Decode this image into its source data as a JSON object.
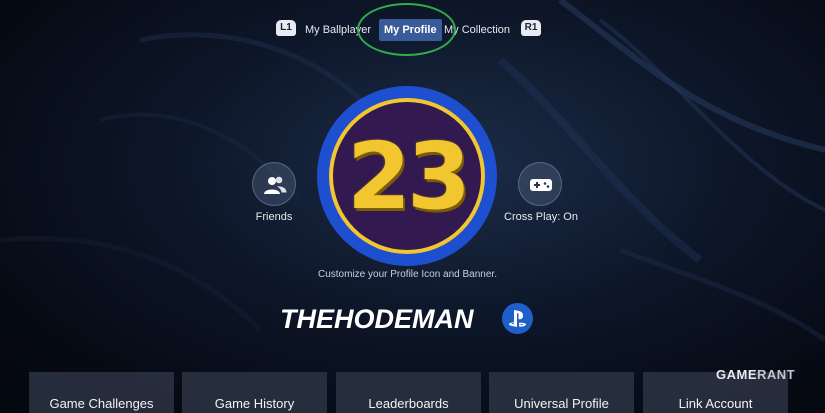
{
  "tabs": {
    "left_bumper": "L1",
    "right_bumper": "R1",
    "items": [
      {
        "label": "My Ballplayer",
        "active": false
      },
      {
        "label": "My Profile",
        "active": true
      },
      {
        "label": "My Collection",
        "active": false
      }
    ]
  },
  "profile": {
    "icon_number": "23",
    "customize_hint": "Customize your Profile Icon and Banner.",
    "username": "THEHODEMAN",
    "platform_icon": "playstation-icon"
  },
  "side_buttons": {
    "friends": {
      "label": "Friends",
      "icon": "friends-icon"
    },
    "crossplay": {
      "label": "Cross Play: On",
      "icon": "gamepad-icon"
    }
  },
  "menu": [
    {
      "label": "Game Challenges"
    },
    {
      "label": "Game History"
    },
    {
      "label": "Leaderboards"
    },
    {
      "label": "Universal Profile"
    },
    {
      "label": "Link Account"
    }
  ],
  "watermark": {
    "part1": "GAME",
    "part2": "RANT"
  },
  "colors": {
    "active_tab": "#3a5b9a",
    "badge_blue": "#1e4fd1",
    "badge_gold": "#f2c62e",
    "badge_purple": "#32194f",
    "highlight_ring": "#2fae4a",
    "psn_blue": "#1f5fc9"
  }
}
